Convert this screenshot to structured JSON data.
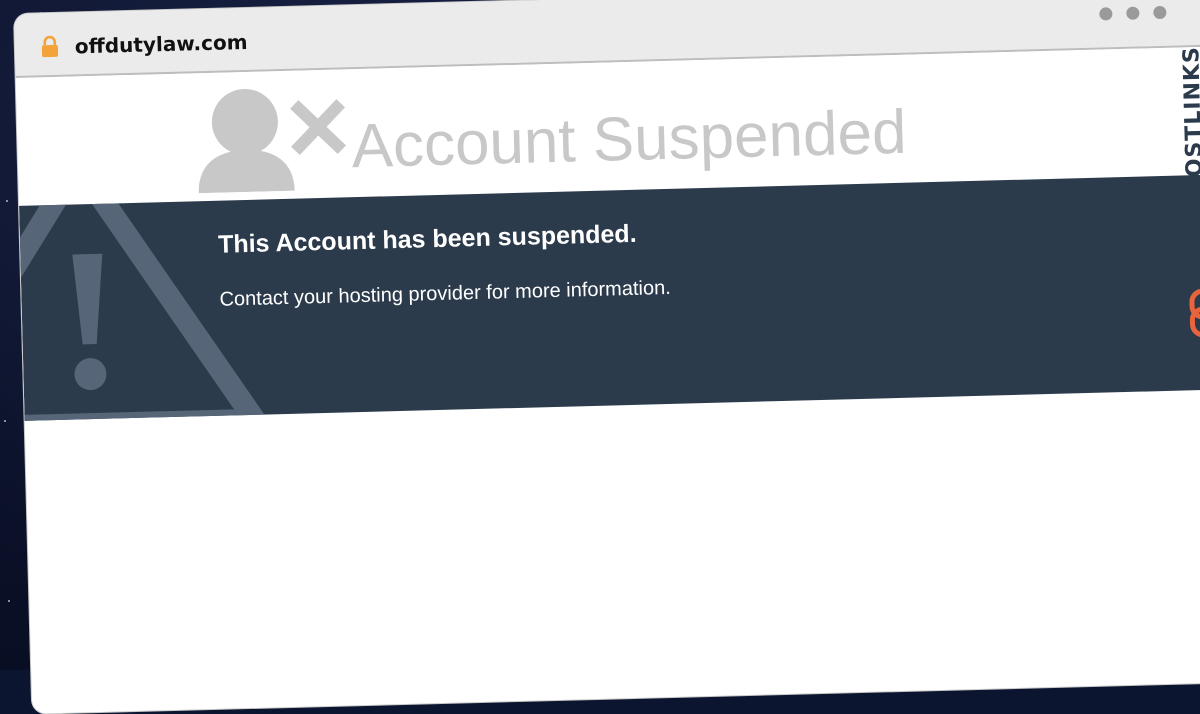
{
  "browser": {
    "url": "offdutylaw.com",
    "lock_icon": "lock-icon",
    "window_controls": [
      "dot",
      "dot",
      "dot"
    ]
  },
  "page": {
    "heading": "Account Suspended",
    "heading_icon": "user-x-icon",
    "banner": {
      "title": "This Account has been suspended.",
      "message": "Contact your hosting provider for more information.",
      "icon": "warning-triangle-icon",
      "background_color": "#2c3b4c"
    }
  },
  "watermark": {
    "text": "GUESTPOSTLINKS",
    "icon": "chain-link-icon",
    "accent_color": "#e8643c"
  }
}
